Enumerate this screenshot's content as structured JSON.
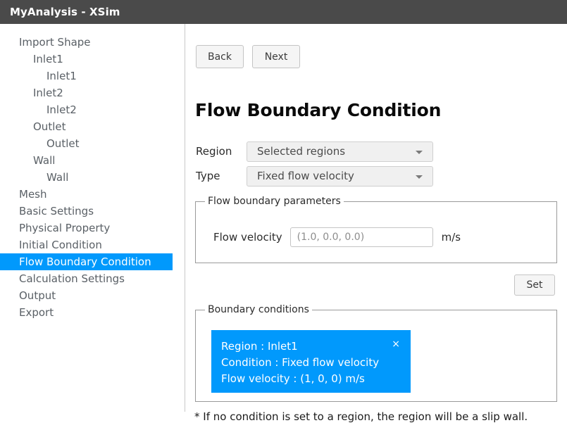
{
  "window": {
    "title": "MyAnalysis - XSim",
    "titlebar_color": "#4a4a4a"
  },
  "accent_color": "#0199fc",
  "sidebar": {
    "items": [
      {
        "label": "Import Shape",
        "level": 0,
        "selected": false
      },
      {
        "label": "Inlet1",
        "level": 1,
        "selected": false
      },
      {
        "label": "Inlet1",
        "level": 2,
        "selected": false
      },
      {
        "label": "Inlet2",
        "level": 1,
        "selected": false
      },
      {
        "label": "Inlet2",
        "level": 2,
        "selected": false
      },
      {
        "label": "Outlet",
        "level": 1,
        "selected": false
      },
      {
        "label": "Outlet",
        "level": 2,
        "selected": false
      },
      {
        "label": "Wall",
        "level": 1,
        "selected": false
      },
      {
        "label": "Wall",
        "level": 2,
        "selected": false
      },
      {
        "label": "Mesh",
        "level": 0,
        "selected": false
      },
      {
        "label": "Basic Settings",
        "level": 0,
        "selected": false
      },
      {
        "label": "Physical Property",
        "level": 0,
        "selected": false
      },
      {
        "label": "Initial Condition",
        "level": 0,
        "selected": false
      },
      {
        "label": "Flow Boundary Condition",
        "level": 0,
        "selected": true
      },
      {
        "label": "Calculation Settings",
        "level": 0,
        "selected": false
      },
      {
        "label": "Output",
        "level": 0,
        "selected": false
      },
      {
        "label": "Export",
        "level": 0,
        "selected": false
      }
    ]
  },
  "main": {
    "nav": {
      "back_label": "Back",
      "next_label": "Next"
    },
    "page_title": "Flow Boundary Condition",
    "region": {
      "label": "Region",
      "value": "Selected regions",
      "arrow_icon": "chevron-down-icon"
    },
    "type": {
      "label": "Type",
      "value": "Fixed flow velocity",
      "arrow_icon": "chevron-down-icon"
    },
    "flow_params": {
      "legend": "Flow boundary parameters",
      "velocity_label": "Flow velocity",
      "velocity_value": "(1.0, 0.0, 0.0)",
      "velocity_unit": "m/s"
    },
    "set_label": "Set",
    "boundary_conditions": {
      "legend": "Boundary conditions",
      "cards": [
        {
          "region": "Region : Inlet1",
          "condition": "Condition : Fixed flow velocity",
          "velocity": "Flow velocity : (1, 0, 0) m/s",
          "close_icon": "×"
        }
      ]
    },
    "footnote": "* If no condition is set to a region, the region will be a slip wall."
  }
}
